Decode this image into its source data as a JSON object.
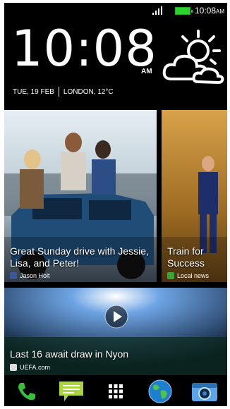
{
  "status_bar": {
    "time": "10:08",
    "ampm": "AM"
  },
  "clock": {
    "time": "10:08",
    "ampm": "AM",
    "date": "TUE, 19 FEB",
    "location": "LONDON, 12°C"
  },
  "cards": [
    {
      "title": "Great Sunday drive with Jessie, Lisa, and Peter!",
      "source": "Jason Holt",
      "source_icon": "facebook-icon"
    },
    {
      "title": "Train for Success",
      "source": "Local news",
      "source_icon": "local-news-icon"
    },
    {
      "title": "Last 16 await draw in Nyon",
      "source": "UEFA.com",
      "source_icon": "uefa-icon"
    }
  ],
  "dock": [
    {
      "icon": "phone-icon"
    },
    {
      "icon": "messages-icon"
    },
    {
      "icon": "app-grid-icon"
    },
    {
      "icon": "browser-globe-icon"
    },
    {
      "icon": "camera-icon"
    }
  ],
  "colors": {
    "background": "#000000",
    "battery": "#2fd12f",
    "phone_green": "#37c13a",
    "message_green": "#a9d63b"
  }
}
